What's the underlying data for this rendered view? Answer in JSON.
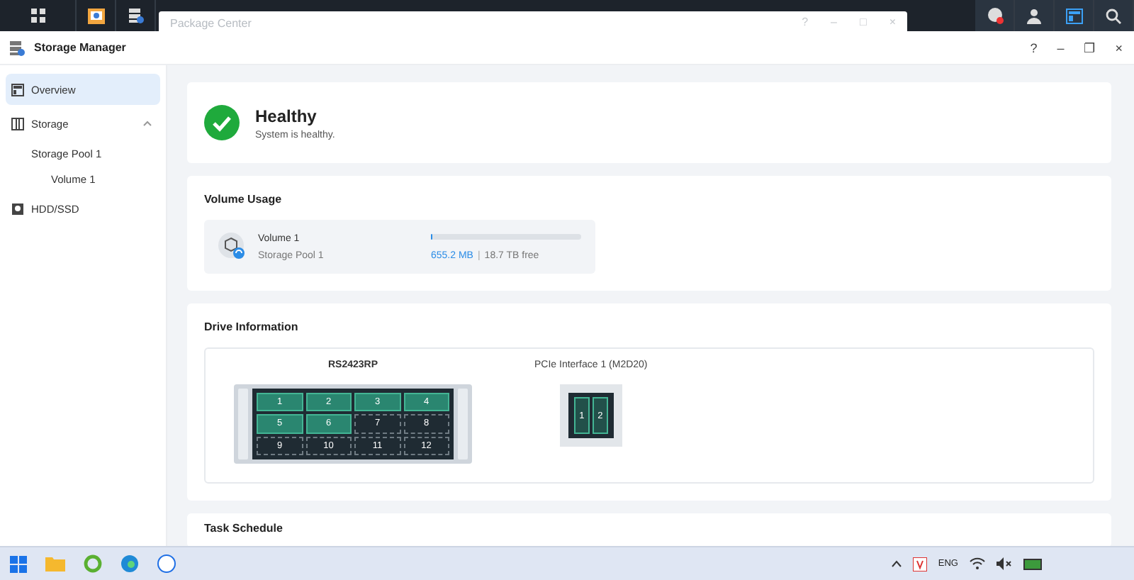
{
  "background_window": {
    "title": "Package Center",
    "controls": [
      "?",
      "–",
      "□",
      "×"
    ]
  },
  "window": {
    "title": "Storage Manager",
    "controls": [
      "?",
      "–",
      "❐",
      "×"
    ]
  },
  "sidebar": {
    "items": [
      {
        "label": "Overview",
        "selected": true
      },
      {
        "label": "Storage",
        "selected": false,
        "expanded": true,
        "children": [
          {
            "label": "Storage Pool 1",
            "selected": false,
            "children": [
              {
                "label": "Volume 1",
                "selected": false
              }
            ]
          }
        ]
      },
      {
        "label": "HDD/SSD",
        "selected": false
      }
    ]
  },
  "health": {
    "status": "Healthy",
    "message": "System is healthy."
  },
  "volume_usage": {
    "title": "Volume Usage",
    "volume": "Volume 1",
    "pool": "Storage Pool 1",
    "used": "655.2 MB",
    "separator": "|",
    "free": "18.7 TB free",
    "level": 0.01
  },
  "drive_information": {
    "title": "Drive Information",
    "model": "RS2423RP",
    "bays": [
      {
        "label": "1",
        "installed": true
      },
      {
        "label": "2",
        "installed": true
      },
      {
        "label": "3",
        "installed": true
      },
      {
        "label": "4",
        "installed": true
      },
      {
        "label": "5",
        "installed": true
      },
      {
        "label": "6",
        "installed": true
      },
      {
        "label": "7",
        "installed": false
      },
      {
        "label": "8",
        "installed": false
      },
      {
        "label": "9",
        "installed": false
      },
      {
        "label": "10",
        "installed": false
      },
      {
        "label": "11",
        "installed": false
      },
      {
        "label": "12",
        "installed": false
      }
    ],
    "pcie_title": "PCIe Interface 1 (M2D20)",
    "m2_slots": [
      {
        "label": "1",
        "installed": true
      },
      {
        "label": "2",
        "installed": true
      }
    ]
  },
  "task_schedule": {
    "title": "Task Schedule"
  },
  "taskbar": {
    "language": "ENG"
  }
}
